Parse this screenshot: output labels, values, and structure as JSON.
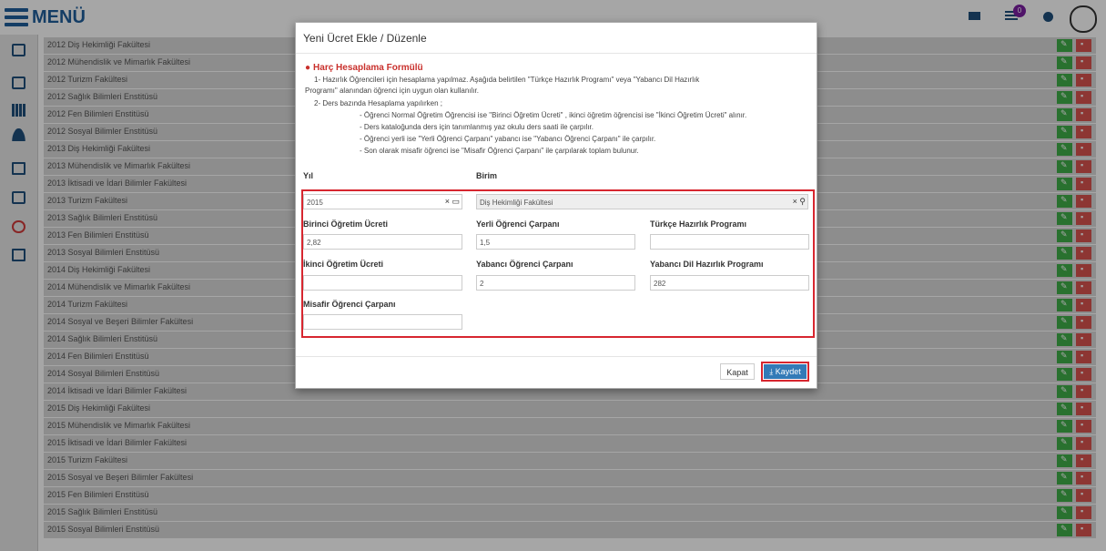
{
  "header": {
    "menu_label": "MENÜ",
    "notification_count": "0"
  },
  "list": {
    "rows": [
      {
        "name": "2012 Diş Hekimliği Fakültesi"
      },
      {
        "name": "2012 Mühendislik ve Mimarlık Fakültesi"
      },
      {
        "name": "2012 Turizm Fakültesi"
      },
      {
        "name": "2012 Sağlık Bilimleri Enstitüsü"
      },
      {
        "name": "2012 Fen Bilimleri Enstitüsü"
      },
      {
        "name": "2012 Sosyal Bilimler Enstitüsü"
      },
      {
        "name": "2013 Diş Hekimliği Fakültesi"
      },
      {
        "name": "2013 Mühendislik ve Mimarlık Fakültesi"
      },
      {
        "name": "2013 İktisadi ve İdari Bilimler Fakültesi"
      },
      {
        "name": "2013 Turizm Fakültesi"
      },
      {
        "name": "2013 Sağlık Bilimleri Enstitüsü"
      },
      {
        "name": "2013 Fen Bilimleri Enstitüsü"
      },
      {
        "name": "2013 Sosyal Bilimleri Enstitüsü"
      },
      {
        "name": "2014 Diş Hekimliği Fakültesi"
      },
      {
        "name": "2014 Mühendislik ve Mimarlık Fakültesi"
      },
      {
        "name": "2014 Turizm Fakültesi"
      },
      {
        "name": "2014 Sosyal ve Beşeri Bilimler Fakültesi"
      },
      {
        "name": "2014 Sağlık Bilimleri Enstitüsü"
      },
      {
        "name": "2014 Fen Bilimleri Enstitüsü"
      },
      {
        "name": "2014 Sosyal Bilimleri Enstitüsü"
      },
      {
        "name": "2014 İktisadi ve İdari Bilimler Fakültesi"
      },
      {
        "name": "2015 Diş Hekimliği Fakültesi"
      },
      {
        "name": "2015 Mühendislik ve Mimarlık Fakültesi"
      },
      {
        "name": "2015 İktisadi ve İdari Bilimler Fakültesi"
      },
      {
        "name": "2015 Turizm Fakültesi"
      },
      {
        "name": "2015 Sosyal ve Beşeri Bilimler Fakültesi"
      },
      {
        "name": "2015 Fen Bilimleri Enstitüsü"
      },
      {
        "name": "2015 Sağlık Bilimleri Enstitüsü"
      },
      {
        "name": "2015 Sosyal Bilimleri Enstitüsü"
      }
    ]
  },
  "modal": {
    "title": "Yeni Ücret Ekle / Düzenle",
    "formula_title": "Harç Hesaplama Formülü",
    "formula_lines": [
      "1- Hazırlık Öğrencileri için hesaplama yapılmaz. Aşağıda belirtilen \"Türkçe Hazırlık Programı\" veya \"Yabancı Dil Hazırlık",
      "Programı\" alanından öğrenci için uygun olan kullanılır.",
      "2- Ders bazında Hesaplama yapılırken ;",
      "- Öğrenci Normal Öğretim Öğrencisi ise \"Birinci Öğretim Ücreti\" , ikinci öğretim öğrencisi ise \"İkinci Öğretim Ücreti\" alınır.",
      "- Ders kataloğunda ders için tanımlanmış yaz okulu ders saati ile çarpılır.",
      "- Öğrenci yerli ise \"Yerli Öğrenci Çarpanı\" yabancı ise \"Yabancı Öğrenci Çarpanı\" ile çarpılır.",
      "- Son olarak misafir öğrenci ise \"Misafir Öğrenci Çarpanı\" ile çarpılarak toplam bulunur."
    ],
    "fields": {
      "yil_label": "Yıl",
      "yil_value": "2015",
      "birim_label": "Birim",
      "birim_value": "Diş Hekimliği Fakültesi",
      "birinci_label": "Birinci Öğretim Ücreti",
      "birinci_value": "2,82",
      "yerli_label": "Yerli Öğrenci Çarpanı",
      "yerli_value": "1,5",
      "turkce_label": "Türkçe Hazırlık Programı",
      "turkce_value": "",
      "ikinci_label": "İkinci Öğretim Ücreti",
      "ikinci_value": "",
      "yabanci_label": "Yabancı Öğrenci Çarpanı",
      "yabanci_value": "2",
      "yabanci_dil_label": "Yabancı Dil Hazırlık Programı",
      "yabanci_dil_value": "282",
      "misafir_label": "Misafir Öğrenci Çarpanı",
      "misafir_value": ""
    },
    "buttons": {
      "close_label": "Kapat",
      "save_label": "Kaydet"
    }
  },
  "icons": {
    "clear": "×",
    "calendar": "▭",
    "search": "⚲",
    "download": "⤓"
  }
}
